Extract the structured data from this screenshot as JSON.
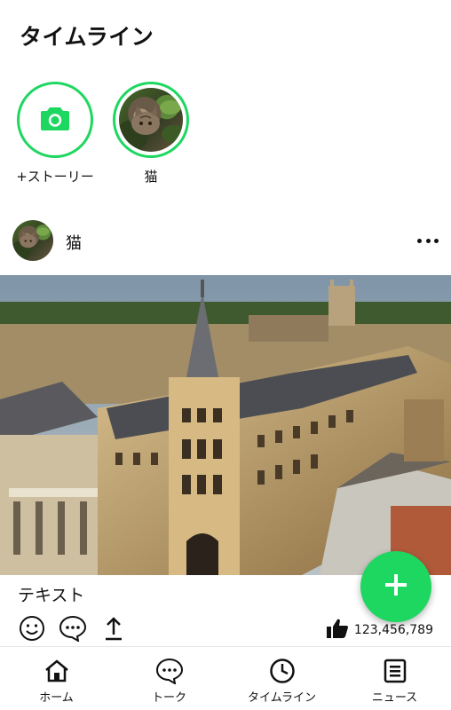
{
  "header": {
    "title": "タイムライン"
  },
  "stories": [
    {
      "label": "+ストーリー",
      "icon": "camera-icon"
    },
    {
      "label": "猫",
      "icon": "cat-avatar"
    }
  ],
  "post": {
    "user": "猫",
    "more_icon": "more-horizontal-icon",
    "text": "テキスト",
    "actions": [
      "smiley-icon",
      "comment-icon",
      "share-icon"
    ],
    "like_icon": "thumbs-up-icon",
    "likes": "123,456,789"
  },
  "fab": {
    "icon": "plus-icon"
  },
  "tabs": [
    {
      "label": "ホーム",
      "icon": "home-icon"
    },
    {
      "label": "トーク",
      "icon": "chat-icon"
    },
    {
      "label": "タイムライン",
      "icon": "clock-icon"
    },
    {
      "label": "ニュース",
      "icon": "news-icon"
    }
  ],
  "colors": {
    "accent": "#1ed760",
    "text": "#111111"
  }
}
